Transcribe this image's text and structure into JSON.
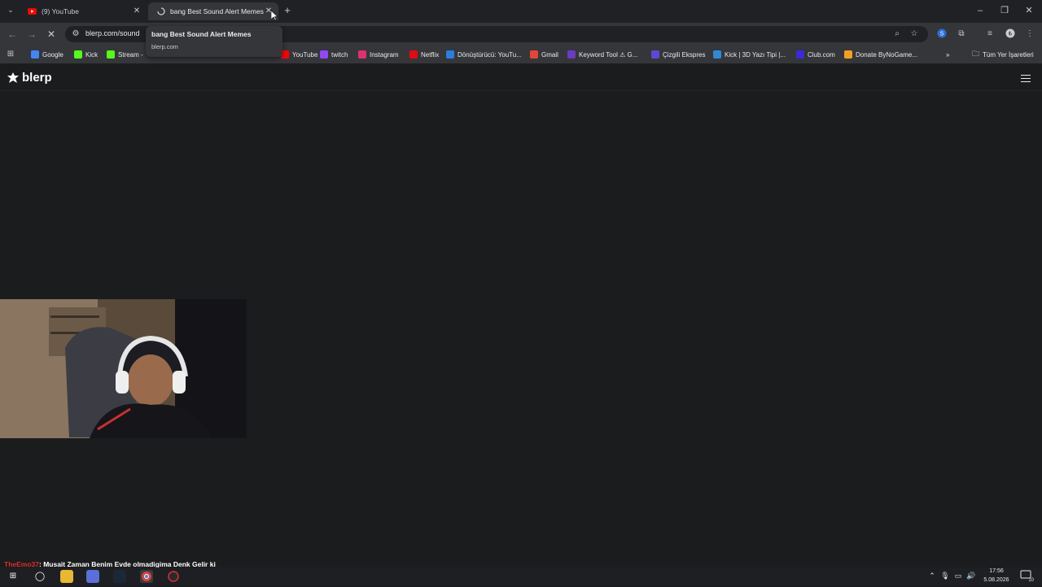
{
  "browser": {
    "tabs": [
      {
        "title": "(9) YouTube",
        "favicon": "youtube-icon",
        "active": false
      },
      {
        "title": "bang Best Sound Alert Memes",
        "favicon": "loading-spinner-icon",
        "active": true
      }
    ],
    "address_bar": {
      "url": "blerp.com/sound"
    },
    "tooltip": {
      "title": "bang Best Sound Alert Memes",
      "domain": "blerp.com"
    },
    "bookmarks": [
      {
        "label": "Google",
        "color": "#4285f4"
      },
      {
        "label": "Kick",
        "color": "#53fc18"
      },
      {
        "label": "Stream -",
        "color": "#53fc18"
      },
      {
        "label": "YouTube",
        "color": "#ff0000"
      },
      {
        "label": "twitch",
        "color": "#9146ff"
      },
      {
        "label": "Instagram",
        "color": "#e1306c"
      },
      {
        "label": "Netflix",
        "color": "#e50914"
      },
      {
        "label": "Dönüştürücü: YouTu...",
        "color": "#2a7de1"
      },
      {
        "label": "Gmail",
        "color": "#ea4335"
      },
      {
        "label": "Keyword Tool ⚠ G...",
        "color": "#6a3cc4"
      },
      {
        "label": "Çizgili Ekspres",
        "color": "#5b4ad1"
      },
      {
        "label": "Kick | 3D Yazı Tipi |...",
        "color": "#2a8cd8"
      },
      {
        "label": "Club.com",
        "color": "#3a2ad8"
      },
      {
        "label": "Donate ByNoGame...",
        "color": "#f0a020"
      }
    ],
    "bookmarks_overflow": "»",
    "all_bookmarks": "Tüm Yer İşaretleri"
  },
  "site": {
    "logo": "blerp"
  },
  "chat_overlay": {
    "user": "TheEmo37",
    "message": ": Musait Zaman Benim Evde olmadigima Denk Gelir ki"
  },
  "taskbar": {
    "time": "17:56",
    "date": "5.08.2026",
    "notification_count": "10"
  },
  "colors": {
    "page_background": "#1b1c1e",
    "chrome_dark": "#202124",
    "chrome_toolbar": "#35363a",
    "chat_user": "#e02b2b"
  }
}
